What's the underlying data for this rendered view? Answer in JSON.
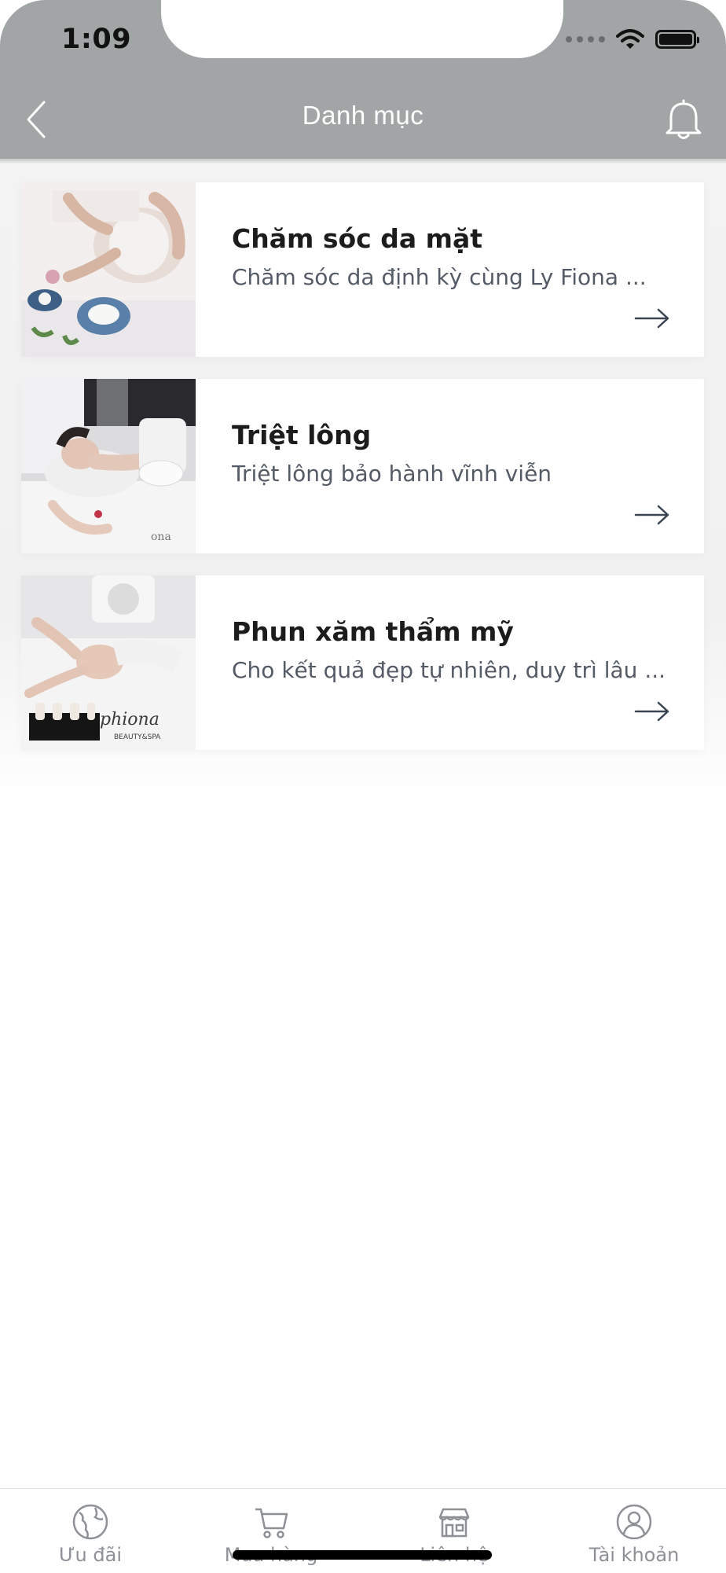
{
  "status_bar": {
    "time": "1:09"
  },
  "header": {
    "title": "Danh mục"
  },
  "categories": [
    {
      "title": "Chăm sóc da mặt",
      "description": "Chăm sóc da định kỳ cùng Ly Fiona ..."
    },
    {
      "title": "Triệt lông",
      "description": "Triệt lông bảo hành vĩnh viễn"
    },
    {
      "title": "Phun xăm thẩm mỹ",
      "description": "Cho kết quả đẹp tự nhiên, duy trì lâu ..."
    }
  ],
  "tabbar": {
    "items": [
      {
        "label": "Ưu đãi",
        "icon": "globe-icon"
      },
      {
        "label": "Mua hàng",
        "icon": "cart-icon"
      },
      {
        "label": "Liên hệ",
        "icon": "store-icon"
      },
      {
        "label": "Tài khoản",
        "icon": "user-icon"
      }
    ]
  },
  "colors": {
    "header_bg": "#a2a5a6",
    "tab_inactive": "#8d9196",
    "title_text": "#1c1c1c"
  }
}
